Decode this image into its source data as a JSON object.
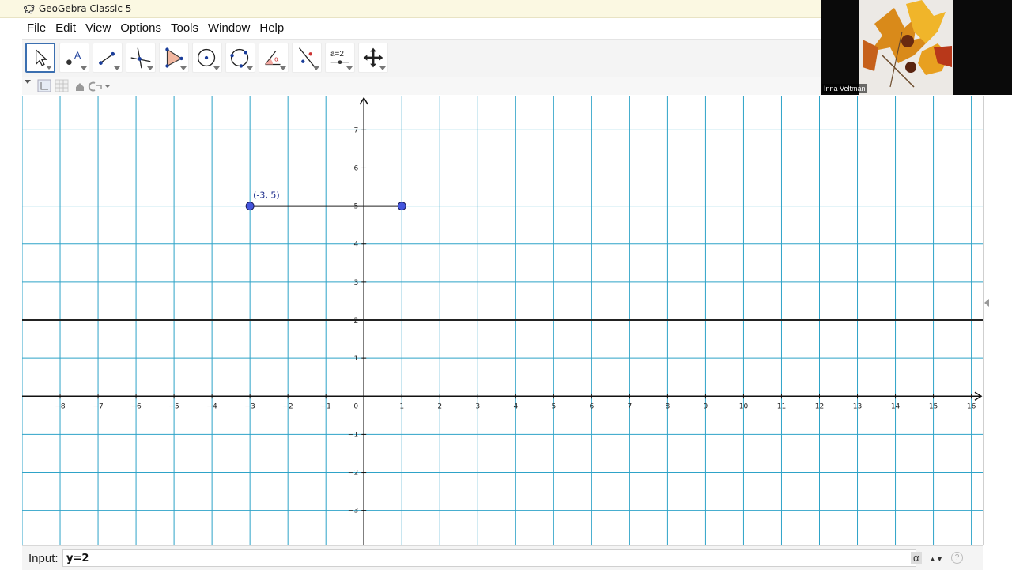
{
  "window": {
    "title": "GeoGebra Classic 5"
  },
  "menu": [
    "File",
    "Edit",
    "View",
    "Options",
    "Tools",
    "Window",
    "Help"
  ],
  "toolbar": {
    "tools": [
      {
        "name": "move-tool",
        "active": true
      },
      {
        "name": "point-tool"
      },
      {
        "name": "line-tool"
      },
      {
        "name": "perpendicular-line-tool"
      },
      {
        "name": "polygon-tool"
      },
      {
        "name": "circle-center-point-tool"
      },
      {
        "name": "circle-three-points-tool"
      },
      {
        "name": "angle-tool"
      },
      {
        "name": "reflect-tool"
      },
      {
        "name": "slider-tool",
        "label": "a=2"
      },
      {
        "name": "move-graphics-view-tool"
      }
    ]
  },
  "video": {
    "participant": "Inna Veltman"
  },
  "graph": {
    "x_range": [
      -9,
      16.3
    ],
    "y_range": [
      -3.9,
      7.9
    ],
    "x_ticks": [
      "-8",
      "-7",
      "-6",
      "-5",
      "-4",
      "-3",
      "-2",
      "-1",
      "0",
      "1",
      "2",
      "3",
      "4",
      "5",
      "6",
      "7",
      "8",
      "9",
      "10",
      "11",
      "12",
      "13",
      "14",
      "15",
      "16"
    ],
    "y_ticks": [
      "7",
      "6",
      "5",
      "4",
      "3",
      "2",
      "1",
      "-1",
      "-2",
      "-3"
    ],
    "grid_color": "#2ea3c8",
    "segment": {
      "from": [
        -3,
        5
      ],
      "to": [
        1,
        5
      ]
    },
    "point_label": "(-3, 5)",
    "point_color": "#4455dd",
    "line_y": 2
  },
  "input": {
    "label": "Input:",
    "value": "y=2",
    "alpha": "α",
    "help": "?"
  }
}
